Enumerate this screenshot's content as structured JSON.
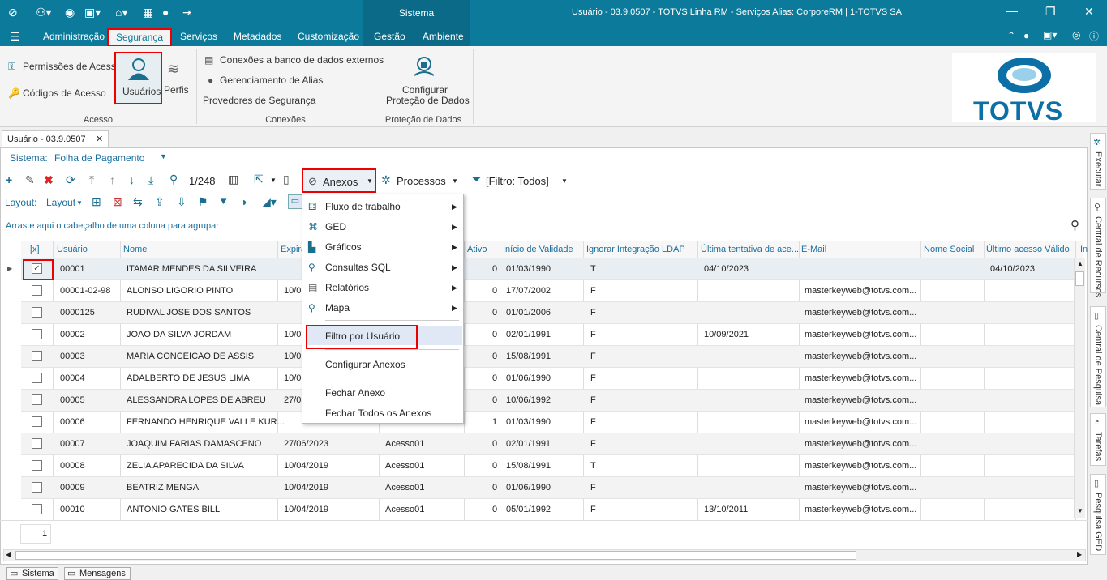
{
  "titlebar": {
    "center_label": "Sistema",
    "title": "Usuário - 03.9.0507 - TOTVS Linha RM - Serviços  Alias: CorporeRM | 1-TOTVS SA"
  },
  "menubar": {
    "items": [
      "Administração",
      "Segurança",
      "Serviços",
      "Metadados",
      "Customização",
      "Gestão",
      "Ambiente"
    ]
  },
  "ribbon": {
    "permissoes": "Permissões de Acesso",
    "codigos": "Códigos de Acesso",
    "usuarios": "Usuários",
    "perfis": "Perfis",
    "group_acesso": "Acesso",
    "conexoes_bd": "Conexões a banco de dados externos",
    "alias": "Gerenciamento de Alias",
    "provedores": "Provedores de Segurança",
    "group_conexoes": "Conexões",
    "configurar_1": "Configurar",
    "configurar_2": "Proteção de Dados",
    "group_protecao": "Proteção de Dados",
    "logo_text": "TOTVS"
  },
  "doc_tab": "Usuário - 03.9.0507",
  "sistema": {
    "label": "Sistema:",
    "value": "Folha de Pagamento"
  },
  "toolbar": {
    "record_pos": "1/248",
    "anexos": "Anexos",
    "processos": "Processos",
    "filtro": "[Filtro: Todos]",
    "layout_label": "Layout:",
    "layout_btn": "Layout"
  },
  "group_hint": "Arraste aqui o cabeçalho de uma coluna para agrupar",
  "columns": [
    "[x]",
    "Usuário",
    "Nome",
    "Expira",
    "Ativo",
    "Início de Validade",
    "Ignorar Integração LDAP",
    "Última tentativa de ace...",
    "E-Mail",
    "Nome Social",
    "Último acesso Válido",
    "In"
  ],
  "rows": [
    {
      "user": "00001",
      "name": "ITAMAR MENDES DA SILVEIRA",
      "exp": "",
      "perfil": "",
      "ativo": "0",
      "inicio": "01/03/1990",
      "ldap": "T",
      "ultima": "04/10/2023",
      "email": "",
      "ultimo": "04/10/2023"
    },
    {
      "user": "00001-02-98",
      "name": "ALONSO LIGORIO PINTO",
      "exp": "10/0",
      "perfil": "",
      "ativo": "0",
      "inicio": "17/07/2002",
      "ldap": "F",
      "ultima": "",
      "email": "masterkeyweb@totvs.com...",
      "ultimo": ""
    },
    {
      "user": "0000125",
      "name": "RUDIVAL JOSE DOS SANTOS",
      "exp": "",
      "perfil": "",
      "ativo": "0",
      "inicio": "01/01/2006",
      "ldap": "F",
      "ultima": "",
      "email": "masterkeyweb@totvs.com...",
      "ultimo": ""
    },
    {
      "user": "00002",
      "name": "JOAO DA SILVA JORDAM",
      "exp": "10/0",
      "perfil": "",
      "ativo": "0",
      "inicio": "02/01/1991",
      "ldap": "F",
      "ultima": "10/09/2021",
      "email": "masterkeyweb@totvs.com...",
      "ultimo": ""
    },
    {
      "user": "00003",
      "name": "MARIA CONCEICAO DE ASSIS",
      "exp": "10/0",
      "perfil": "",
      "ativo": "0",
      "inicio": "15/08/1991",
      "ldap": "F",
      "ultima": "",
      "email": "masterkeyweb@totvs.com...",
      "ultimo": ""
    },
    {
      "user": "00004",
      "name": "ADALBERTO DE JESUS LIMA",
      "exp": "10/0",
      "perfil": "",
      "ativo": "0",
      "inicio": "01/06/1990",
      "ldap": "F",
      "ultima": "",
      "email": "masterkeyweb@totvs.com...",
      "ultimo": ""
    },
    {
      "user": "00005",
      "name": "ALESSANDRA LOPES DE ABREU",
      "exp": "27/0",
      "perfil": "",
      "ativo": "0",
      "inicio": "10/06/1992",
      "ldap": "F",
      "ultima": "",
      "email": "masterkeyweb@totvs.com...",
      "ultimo": ""
    },
    {
      "user": "00006",
      "name": "FERNANDO HENRIQUE VALLE KUR...",
      "exp": "",
      "perfil": "",
      "ativo": "1",
      "inicio": "01/03/1990",
      "ldap": "F",
      "ultima": "",
      "email": "masterkeyweb@totvs.com...",
      "ultimo": ""
    },
    {
      "user": "00007",
      "name": "JOAQUIM FARIAS DAMASCENO",
      "exp": "27/06/2023",
      "perfil": "Acesso01",
      "ativo": "0",
      "inicio": "02/01/1991",
      "ldap": "F",
      "ultima": "",
      "email": "masterkeyweb@totvs.com...",
      "ultimo": ""
    },
    {
      "user": "00008",
      "name": "ZELIA APARECIDA DA SILVA",
      "exp": "10/04/2019",
      "perfil": "Acesso01",
      "ativo": "0",
      "inicio": "15/08/1991",
      "ldap": "T",
      "ultima": "",
      "email": "masterkeyweb@totvs.com...",
      "ultimo": ""
    },
    {
      "user": "00009",
      "name": "BEATRIZ MENGA",
      "exp": "10/04/2019",
      "perfil": "Acesso01",
      "ativo": "0",
      "inicio": "01/06/1990",
      "ldap": "F",
      "ultima": "",
      "email": "masterkeyweb@totvs.com...",
      "ultimo": ""
    },
    {
      "user": "00010",
      "name": "ANTONIO GATES BILL",
      "exp": "10/04/2019",
      "perfil": "Acesso01",
      "ativo": "0",
      "inicio": "05/01/1992",
      "ldap": "F",
      "ultima": "13/10/2011",
      "email": "masterkeyweb@totvs.com...",
      "ultimo": ""
    }
  ],
  "menu": {
    "fluxo": "Fluxo de trabalho",
    "ged": "GED",
    "graficos": "Gráficos",
    "consultas": "Consultas SQL",
    "relatorios": "Relatórios",
    "mapa": "Mapa",
    "filtro_usuario": "Filtro por Usuário",
    "configurar": "Configurar Anexos",
    "fechar": "Fechar Anexo",
    "fechar_todos": "Fechar Todos os Anexos"
  },
  "footer": {
    "page": "1"
  },
  "rightbar": [
    "Executar",
    "Central de Recursos",
    "Central de Pesquisa",
    "Tarefas",
    "Pesquisa GED"
  ],
  "statusbar": {
    "sistema": "Sistema",
    "mensagens": "Mensagens"
  }
}
